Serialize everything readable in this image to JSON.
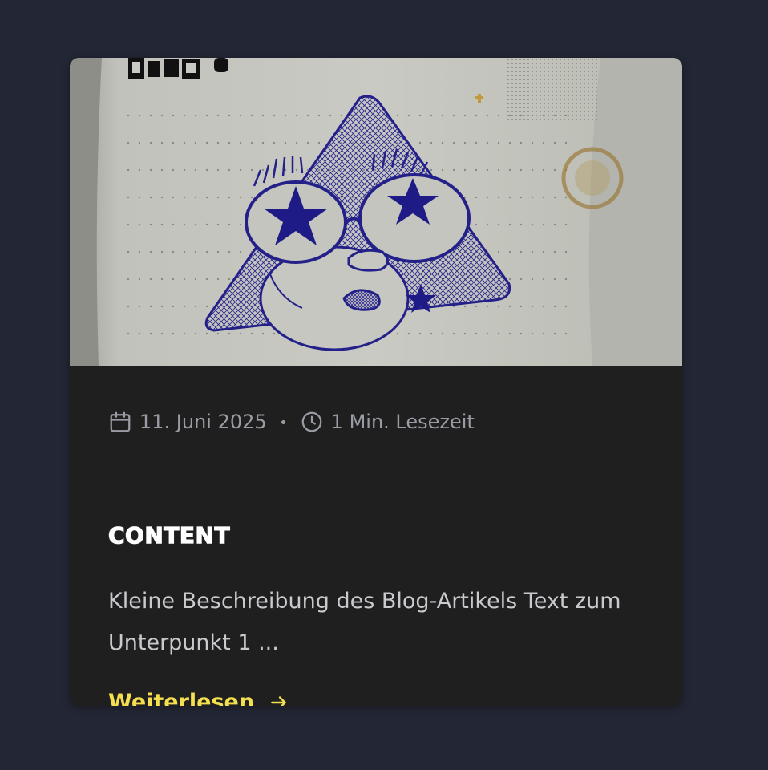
{
  "card": {
    "image": {
      "alt": "Kugelschreiber-Zeichnung eines Gesichts mit Sternenaugen auf gepunktetem Papier",
      "icon": "image"
    },
    "meta": {
      "date": "11. Juni 2025",
      "date_icon": "calendar-icon",
      "read_time": "1 Min. Lesezeit",
      "read_time_icon": "clock-icon"
    },
    "category": "CONTENT",
    "description": "Kleine Beschreibung des Blog-Artikels Text zum Unterpunkt 1 ...",
    "read_more": {
      "label": "Weiterlesen",
      "icon": "arrow-right-icon"
    }
  },
  "colors": {
    "page_background": "#232634",
    "card_background": "#1f1f20",
    "accent": "#f3df4f",
    "meta_text": "#9a9ca3",
    "body_text": "#c9cacd",
    "heading_text": "#ffffff",
    "ink": "#24208a"
  }
}
